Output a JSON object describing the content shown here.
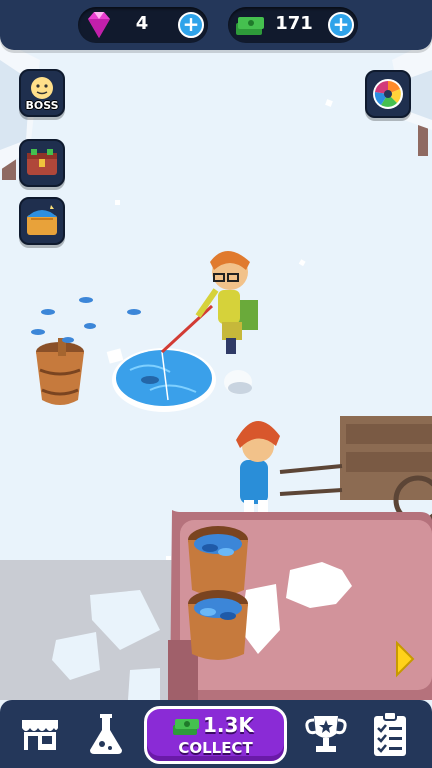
{
  "currency": {
    "gems": "4",
    "cash": "171"
  },
  "side_buttons": {
    "boss_label": "BOSS"
  },
  "collect_button": {
    "amount": "1.3K",
    "label": "COLLECT"
  },
  "colors": {
    "bar_background": "#24375a",
    "pill_background": "#111a2d",
    "plus_button": "#2fa3ea",
    "collect_button": "#8a2bd6",
    "snow": "#e9f3fb",
    "ice_hole": "#3aa0ea",
    "truck": "#b5727c"
  },
  "icons": {
    "gem": "gem-icon",
    "cash": "cash-stack-icon",
    "boss": "boss-icon",
    "chest": "treasure-chest-icon",
    "map": "treasure-map-icon",
    "wheel": "color-wheel-icon",
    "shop": "shop-icon",
    "lab": "flask-icon",
    "trophy": "trophy-icon",
    "tasks": "clipboard-checklist-icon",
    "next": "arrow-right-icon"
  }
}
